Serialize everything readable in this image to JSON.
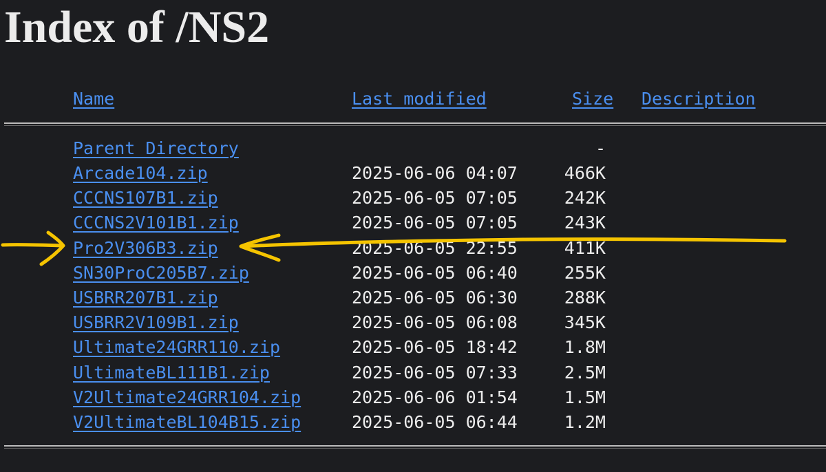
{
  "page": {
    "title": "Index of /NS2"
  },
  "header": {
    "name": "Name",
    "last_modified": "Last modified",
    "size": "Size",
    "description": "Description"
  },
  "parent": {
    "label": "Parent Directory",
    "size": "-"
  },
  "files": [
    {
      "name": "Arcade104.zip",
      "modified": "2025-06-06 04:07",
      "size": "466K"
    },
    {
      "name": "CCCNS107B1.zip",
      "modified": "2025-06-05 07:05",
      "size": "242K"
    },
    {
      "name": "CCCNS2V101B1.zip",
      "modified": "2025-06-05 07:05",
      "size": "243K"
    },
    {
      "name": "Pro2V306B3.zip",
      "modified": "2025-06-05 22:55",
      "size": "411K"
    },
    {
      "name": "SN30ProC205B7.zip",
      "modified": "2025-06-05 06:40",
      "size": "255K"
    },
    {
      "name": "USBRR207B1.zip",
      "modified": "2025-06-05 06:30",
      "size": "288K"
    },
    {
      "name": "USBRR2V109B1.zip",
      "modified": "2025-06-05 06:08",
      "size": "345K"
    },
    {
      "name": "Ultimate24GRR110.zip",
      "modified": "2025-06-05 18:42",
      "size": "1.8M"
    },
    {
      "name": "UltimateBL111B1.zip",
      "modified": "2025-06-05 07:33",
      "size": "2.5M"
    },
    {
      "name": "V2Ultimate24GRR104.zip",
      "modified": "2025-06-06 01:54",
      "size": "1.5M"
    },
    {
      "name": "V2UltimateBL104B15.zip",
      "modified": "2025-06-05 06:44",
      "size": "1.2M"
    }
  ],
  "colors": {
    "background": "#1c1d20",
    "link": "#4a8ff0",
    "text": "#ececec",
    "annotation": "#f5c400"
  },
  "annotation": {
    "description_icon": "yellow-hand-drawn-arrows-and-strike-line"
  }
}
